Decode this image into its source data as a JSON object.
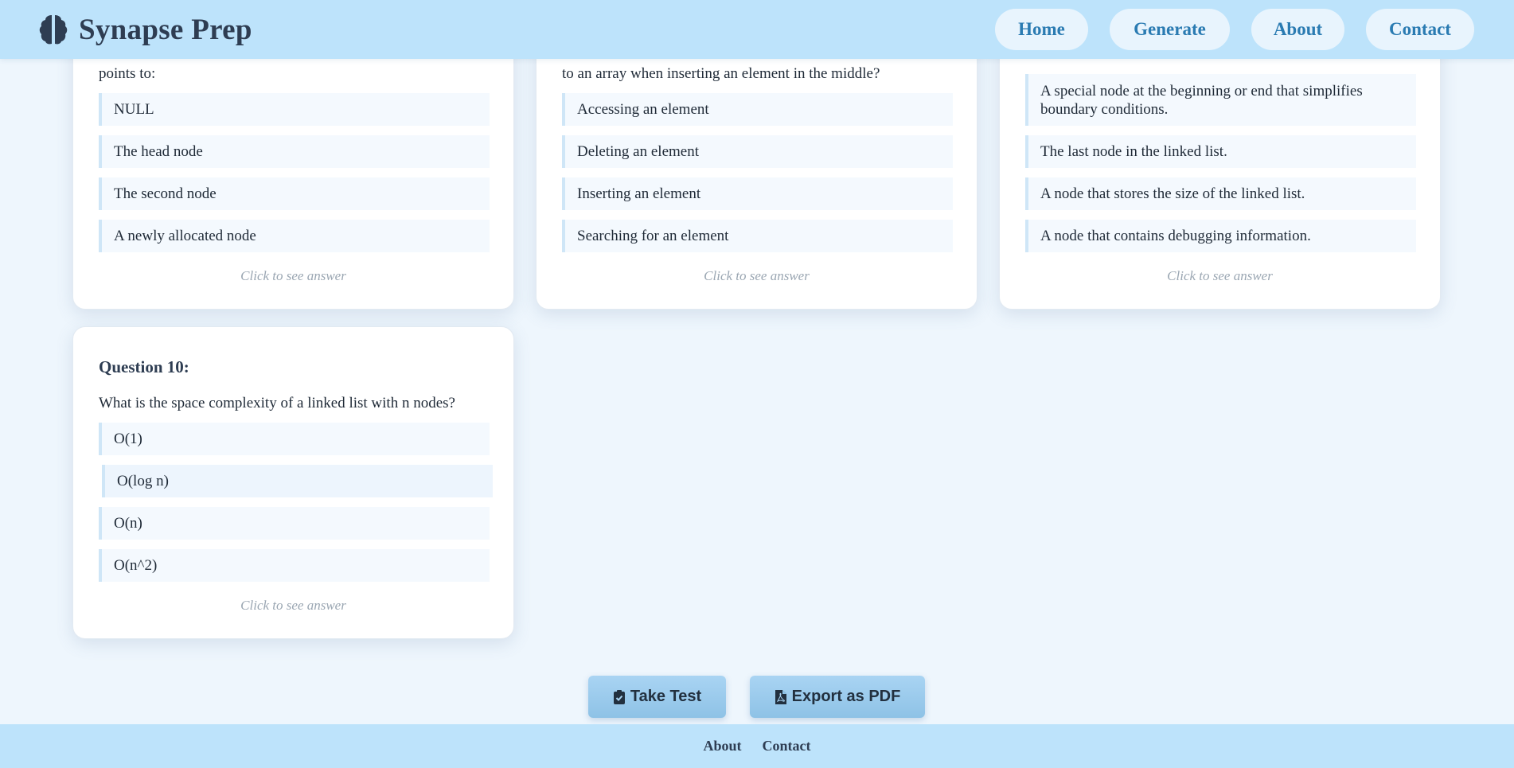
{
  "app": {
    "title": "Synapse Prep",
    "icon": "brain-icon"
  },
  "nav": {
    "home": "Home",
    "generate": "Generate",
    "about": "About",
    "contact": "Contact"
  },
  "cards": [
    {
      "question_tail": "points to:",
      "options": [
        "NULL",
        "The head node",
        "The second node",
        "A newly allocated node"
      ],
      "reveal": "Click to see answer"
    },
    {
      "question_tail": "to an array when inserting an element in the middle?",
      "options": [
        "Accessing an element",
        "Deleting an element",
        "Inserting an element",
        "Searching for an element"
      ],
      "reveal": "Click to see answer"
    },
    {
      "question_tail": "",
      "options": [
        "A special node at the beginning or end that simplifies boundary conditions.",
        "The last node in the linked list.",
        "A node that stores the size of the linked list.",
        "A node that contains debugging information."
      ],
      "reveal": "Click to see answer"
    },
    {
      "title": "Question 10:",
      "question": "What is the space complexity of a linked list with n nodes?",
      "options": [
        "O(1)",
        "O(log n)",
        "O(n)",
        "O(n^2)"
      ],
      "reveal": "Click to see answer"
    }
  ],
  "actions": {
    "take_test": "Take Test",
    "take_test_icon": "clipboard-check-icon",
    "export_pdf": "Export as PDF",
    "export_pdf_icon": "file-pdf-icon"
  },
  "footer": {
    "about": "About",
    "contact": "Contact"
  },
  "colors": {
    "header_bg": "#bde3fb",
    "page_bg": "#eef6fd",
    "nav_text": "#2a7bb2",
    "button_bg": "#a9d4f3"
  }
}
